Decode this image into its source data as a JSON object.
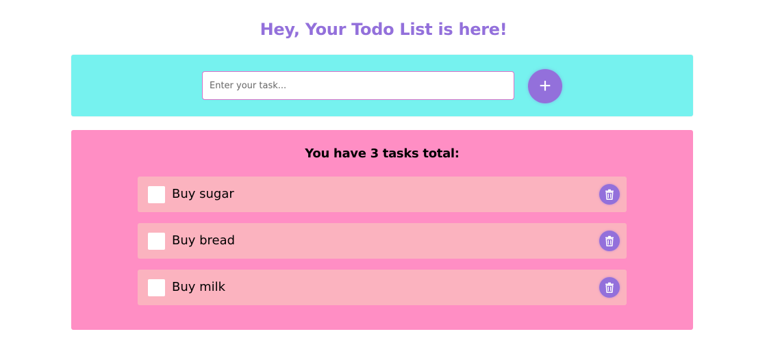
{
  "header": {
    "title": "Hey, Your Todo List is here!"
  },
  "input_form": {
    "placeholder": "Enter your task...",
    "value": "",
    "add_button_icon": "plus-icon",
    "add_button_symbol": "+"
  },
  "tasks_panel": {
    "heading": "You have 3 tasks total:",
    "items": [
      {
        "label": "Buy sugar",
        "checked": false,
        "delete_icon": "trash-icon"
      },
      {
        "label": "Buy bread",
        "checked": false,
        "delete_icon": "trash-icon"
      },
      {
        "label": "Buy milk",
        "checked": false,
        "delete_icon": "trash-icon"
      }
    ]
  },
  "colors": {
    "accent": "#9370db",
    "input_panel_bg": "#76f2ef",
    "list_panel_bg": "#ff8ec4",
    "task_item_bg": "#fbb3bf"
  }
}
